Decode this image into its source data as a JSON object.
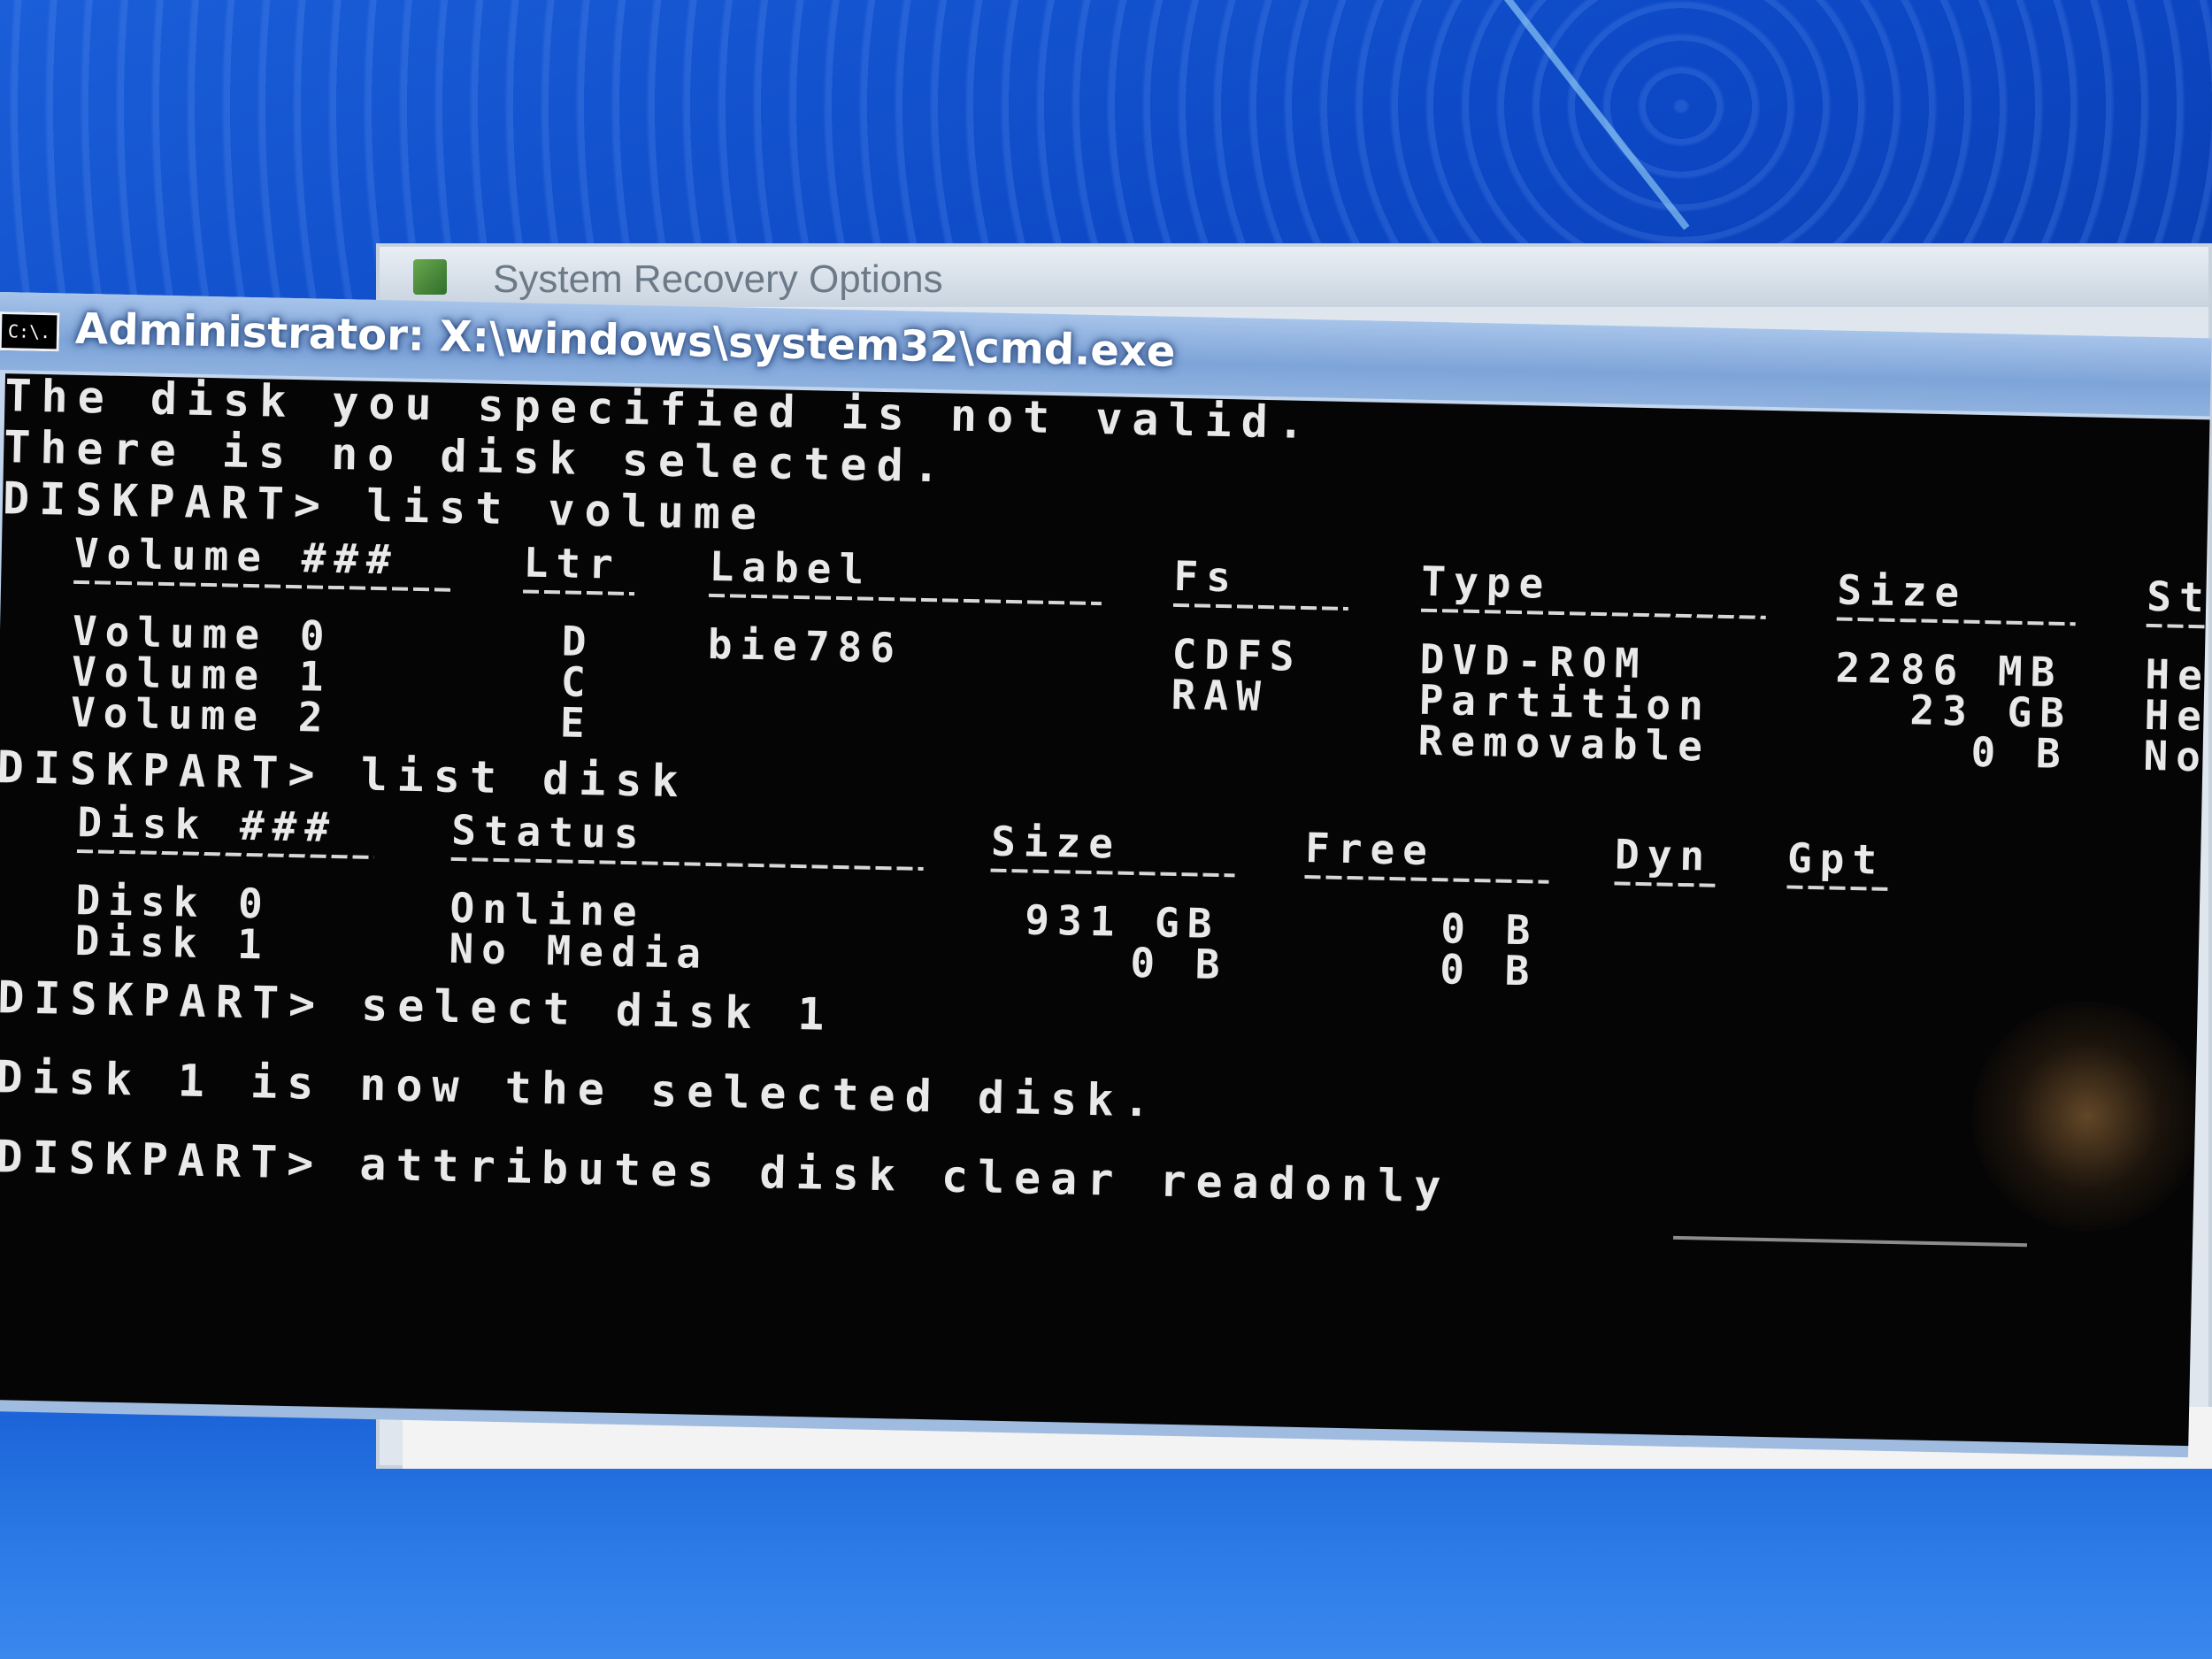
{
  "recovery_window": {
    "title": "System Recovery Options"
  },
  "cmd_window": {
    "icon_text": "C:\\.",
    "title": "Administrator: X:\\windows\\system32\\cmd.exe"
  },
  "console": {
    "lines": {
      "line1": "The disk you specified is not valid.",
      "line2": "There is no disk selected.",
      "cmd1": "DISKPART> list volume",
      "cmd2": "DISKPART> list disk",
      "cmd3": "DISKPART> select disk 1",
      "msg3": "Disk 1 is now the selected disk.",
      "cmd4": "DISKPART> attributes disk clear readonly"
    },
    "volume_table": {
      "headers": {
        "volume": "Volume ###",
        "ltr": "Ltr",
        "label": "Label",
        "fs": "Fs",
        "type": "Type",
        "size": "Size",
        "status": "St"
      },
      "rows": [
        {
          "volume": "Volume 0",
          "ltr": "D",
          "label": "bie786",
          "fs": "CDFS",
          "type": "DVD-ROM",
          "size": "2286 MB",
          "status": "He"
        },
        {
          "volume": "Volume 1",
          "ltr": "C",
          "label": "",
          "fs": "RAW",
          "type": "Partition",
          "size": "23 GB",
          "status": "He"
        },
        {
          "volume": "Volume 2",
          "ltr": "E",
          "label": "",
          "fs": "",
          "type": "Removable",
          "size": "0 B",
          "status": "No"
        }
      ]
    },
    "disk_table": {
      "headers": {
        "disk": "Disk ###",
        "status": "Status",
        "size": "Size",
        "free": "Free",
        "dyn": "Dyn",
        "gpt": "Gpt"
      },
      "rows": [
        {
          "disk": "Disk 0",
          "status": "Online",
          "size": "931 GB",
          "free": "0 B"
        },
        {
          "disk": "Disk 1",
          "status": "No Media",
          "size": "0 B",
          "free": "0 B"
        }
      ]
    }
  }
}
